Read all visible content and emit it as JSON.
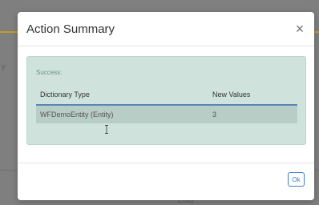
{
  "dialog": {
    "title": "Action Summary",
    "close_glyph": "×"
  },
  "alert": {
    "label": "Success:",
    "columns": [
      "Dictionary Type",
      "New Values"
    ],
    "rows": [
      {
        "type": "WFDemoEntity (Entity)",
        "values": "3"
      }
    ]
  },
  "footer": {
    "ok_label": "Ok"
  },
  "background": {
    "left_fragment": "y",
    "bottom_fragment": "Entity"
  },
  "colors": {
    "alert_bg": "#cfe3dc",
    "table_row_bg": "#b8cdc6",
    "header_underline": "#5a86b5",
    "ok_button": "#3c7fc4",
    "overlay": "#7f7f7f"
  },
  "icons": {
    "close": "close-icon",
    "cursor": "text-cursor-icon"
  }
}
